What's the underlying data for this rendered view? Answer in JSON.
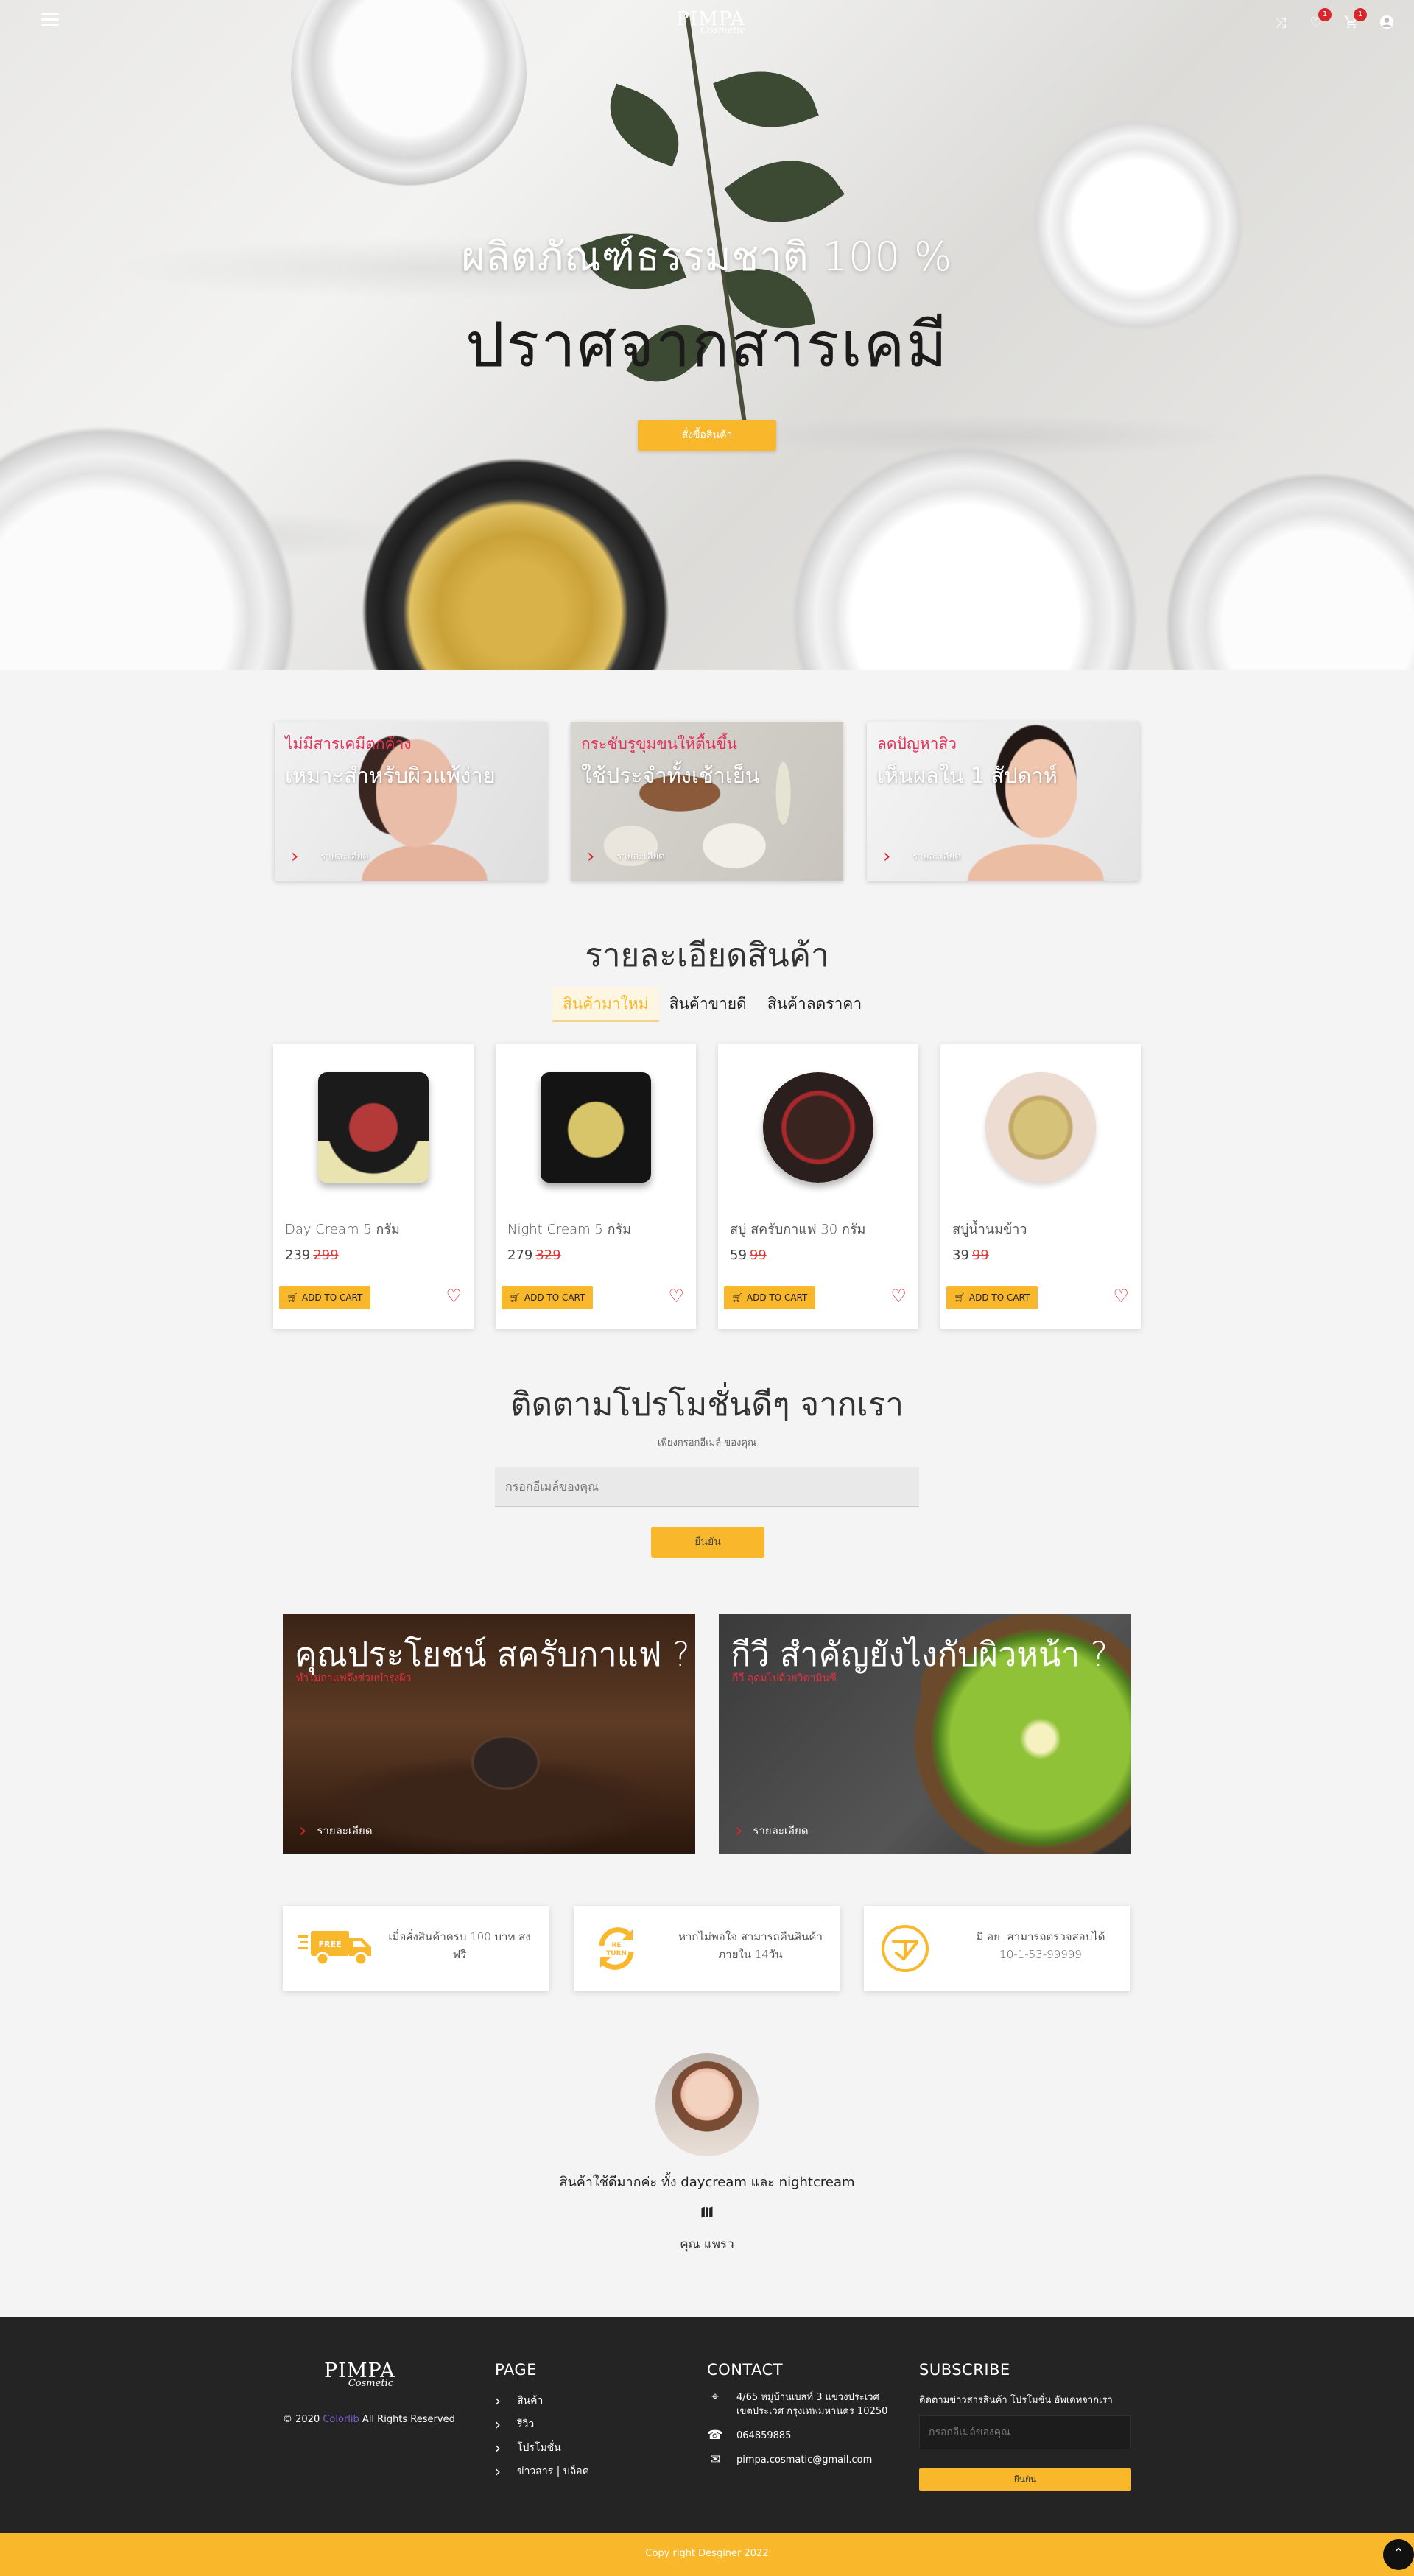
{
  "brand": {
    "name": "PIMPA",
    "sub": "Cosmetic"
  },
  "nav": {
    "wishlist_count": "1",
    "cart_count": "1"
  },
  "hero": {
    "line1": "ผลิตภัณฑ์ธรรมชาติ 100 %",
    "line2": "ปราศจากสารเคมี",
    "button": "สั่งซื้อสินค้า"
  },
  "features": [
    {
      "line1": "ไม่มีสารเคมีตกค้าง",
      "line2": "เหมาะสำหรับผิวแพ้ง่าย",
      "more": "รายละเอียด"
    },
    {
      "line1": "กระชับรูขุมขนให้ตื้นขึ้น",
      "line2": "ใช้ประจำทั้งเช้าเย็น",
      "more": "รายละเอียด"
    },
    {
      "line1": "ลดปัญหาสิว",
      "line2": "เห็นผลใน 1 สัปดาห์",
      "more": "รายละเอียด"
    }
  ],
  "products_section": {
    "title": "รายละเอียดสินค้า",
    "tabs": [
      "สินค้ามาใหม่",
      "สินค้าขายดี",
      "สินค้าลดราคา"
    ],
    "add_to_cart": "ADD TO CART",
    "items": [
      {
        "name": "Day Cream 5 กรัม",
        "price": "239",
        "old_price": "299",
        "color": "#1b1b1b",
        "label_color": "#e9e3b0"
      },
      {
        "name": "Night Cream 5 กรัม",
        "price": "279",
        "old_price": "329",
        "color": "#141414",
        "label_color": "#d8c56a"
      },
      {
        "name": "สบู่ สครับกาแฟ 30 กรัม",
        "price": "59",
        "old_price": "99",
        "color": "#2a1f1c",
        "label_color": "#a8282c"
      },
      {
        "name": "สบู่น้ำนมข้าว",
        "price": "39",
        "old_price": "99",
        "color": "#e7d2c7",
        "label_color": "#e7c99a"
      }
    ]
  },
  "subscribe": {
    "title": "ติดตามโปรโมชั่นดีๆ จากเรา",
    "subtitle": "เพียงกรอกอีเมล์ ของคุณ",
    "placeholder": "กรอกอีเมล์ของคุณ",
    "button": "ยืนยัน"
  },
  "blog": [
    {
      "title": "คุณประโยชน์ สครับกาแฟ ?",
      "subtitle": "ทำไมกาแฟจึงช่วยบำรุงผิว",
      "more": "รายละเอียด"
    },
    {
      "title": "กีวี สำคัญยังไงกับผิวหน้า ?",
      "subtitle": "กีวี อุดมไปด้วยวิตามินซี",
      "more": "รายละเอียด"
    }
  ],
  "services": [
    {
      "icon": "free-delivery-icon",
      "text": "เมื่อสั่งสินค้าครบ 100 บาท ส่งฟรี",
      "badge": "FREE"
    },
    {
      "icon": "return-icon",
      "text": "หากไม่พอใจ สามารถคืนสินค้า ภายใน 14วัน",
      "badge": "RE TURN"
    },
    {
      "icon": "verified-icon",
      "text": "มี อย. สามารถตรวจสอบได้ 10-1-53-99999",
      "badge": ""
    }
  ],
  "testimonial": {
    "quote": "สินค้าใช้ดีมากค่ะ ทั้ง daycream และ nightcream",
    "author": "คุณ แพรว"
  },
  "footer": {
    "copyright_prefix": "© 2020",
    "copyright_highlight": "Colorlib",
    "copyright_suffix": "All Rights Reserved",
    "page_heading": "PAGE",
    "page_links": [
      "สินค้า",
      "รีวิว",
      "โปรโมชั่น",
      "ข่าวสาร | บล็อค"
    ],
    "contact_heading": "CONTACT",
    "address": "4/65 หมู่บ้านเบสท์ 3 แขวงประเวศ เขตประเวศ กรุงเทพมหานคร 10250",
    "phone": "064859885",
    "email": "pimpa.cosmatic@gmail.com",
    "subscribe_heading": "SUBSCRIBE",
    "subscribe_text": "ติดตามข่าวสารสินค้า โปรโมชั่น อัพเดทจากเรา",
    "subscribe_placeholder": "กรอกอีเมล์ของคุณ",
    "subscribe_button": "ยืนยัน",
    "bottom": "Copy right Desginer 2022"
  },
  "colors": {
    "accent": "#f9b82c",
    "badge": "#d9262c",
    "price_old": "#e53838",
    "footer_bg": "#242424"
  }
}
